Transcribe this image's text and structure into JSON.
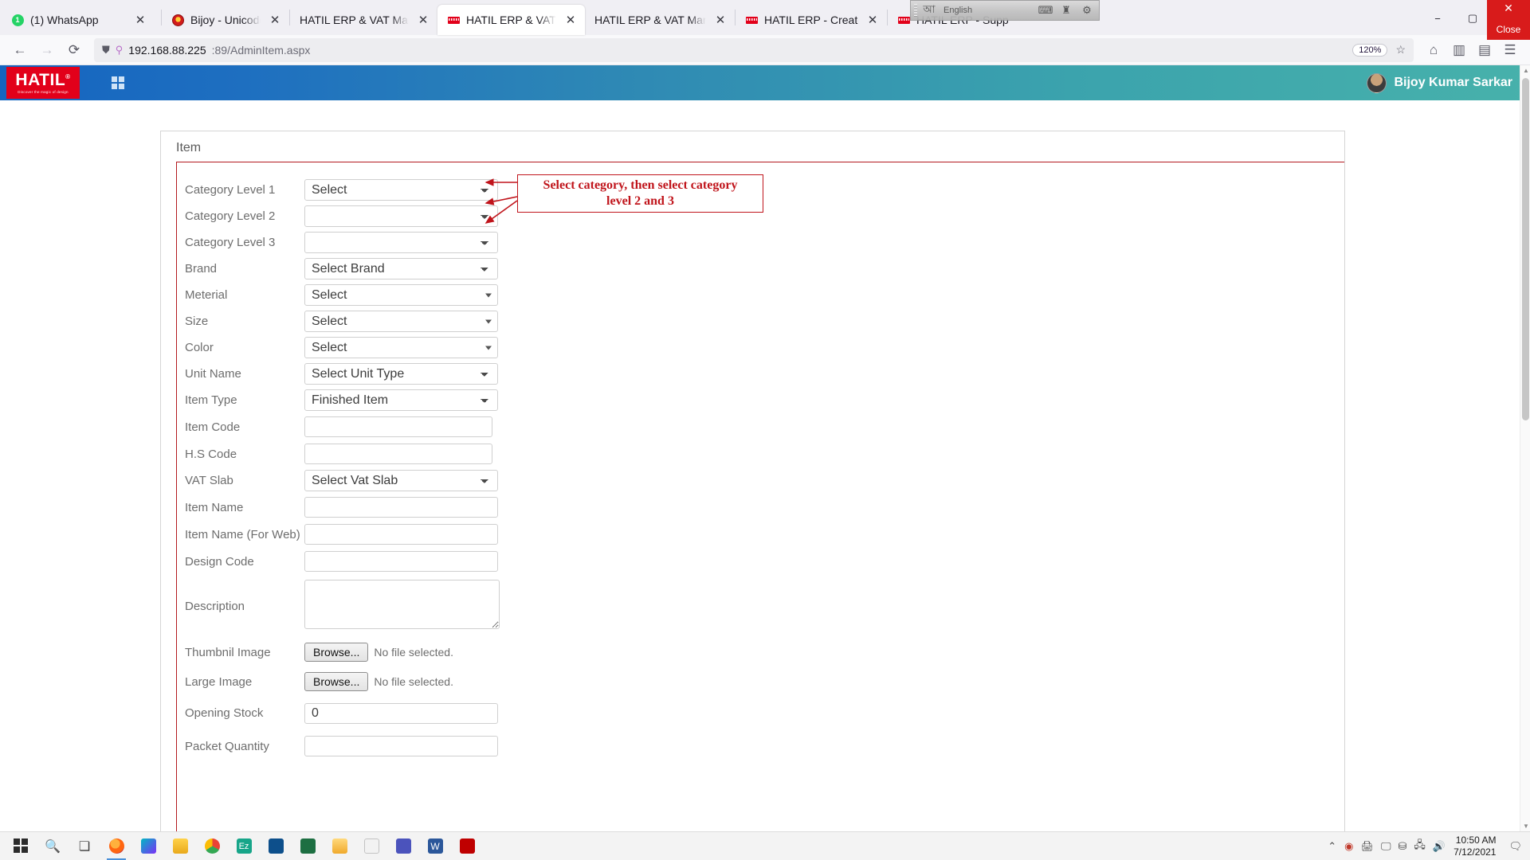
{
  "browser": {
    "tabs": [
      {
        "title": "(1) WhatsApp",
        "favicon": "whatsapp-icon",
        "active": false,
        "closable": true
      },
      {
        "title": "Bijoy - Unicode Converter | বিজ",
        "favicon": "bijoy-icon",
        "active": false,
        "closable": true
      },
      {
        "title": "HATIL ERP & VAT Management Syst",
        "favicon": "none",
        "active": false,
        "closable": true
      },
      {
        "title": "HATIL ERP & VAT Management",
        "favicon": "hatil-icon",
        "active": true,
        "closable": true
      },
      {
        "title": "HATIL ERP & VAT Management Syst",
        "favicon": "none",
        "active": false,
        "closable": true
      },
      {
        "title": "HATIL ERP - Create CDC User",
        "favicon": "hatil-icon",
        "active": false,
        "closable": true
      },
      {
        "title": "HATIL ERP - Supplier",
        "favicon": "hatil-icon",
        "active": false,
        "closable": false
      }
    ],
    "window_controls": {
      "minimize": "−",
      "maximize": "▢",
      "close": "✕"
    },
    "nav": {
      "back": "←",
      "forward": "→",
      "reload": "⟳",
      "shield_icon": "shield-icon",
      "tracking_icon": "tracking-protection-icon",
      "url_host": "192.168.88.225",
      "url_rest": ":89/AdminItem.aspx",
      "zoom_level": "120%",
      "bookmark_icon": "star-icon",
      "pocket_icon": "save-to-pocket-icon",
      "library_icon": "library-icon",
      "sidebar_icon": "sidebar-icon",
      "menu_icon": "hamburger-menu-icon"
    },
    "ime_bar": {
      "language": "English",
      "icons": [
        "ime-mode-icon",
        "keyboard-icon",
        "tool-icon",
        "settings-icon"
      ]
    },
    "overlay_close": {
      "label": "Close",
      "mark": "✕"
    }
  },
  "app": {
    "brand": {
      "name": "HATIL",
      "registered": "®",
      "tagline": "Discover the magic of design"
    },
    "grid_icon": "app-grid-icon",
    "user": {
      "name": "Bijoy Kumar Sarkar",
      "avatar": "user-avatar"
    }
  },
  "form": {
    "card_title": "Item",
    "fields": [
      {
        "label": "Category Level 1",
        "type": "select",
        "value": "Select",
        "arrow": "chevron"
      },
      {
        "label": "Category Level 2",
        "type": "select",
        "value": "",
        "arrow": "chevron"
      },
      {
        "label": "Category Level 3",
        "type": "select",
        "value": "",
        "arrow": "chevron"
      },
      {
        "label": "Brand",
        "type": "select",
        "value": "Select Brand",
        "arrow": "chevron"
      },
      {
        "label": "Meterial",
        "type": "select",
        "value": "Select",
        "arrow": "triangle"
      },
      {
        "label": "Size",
        "type": "select",
        "value": "Select",
        "arrow": "triangle"
      },
      {
        "label": "Color",
        "type": "select",
        "value": "Select",
        "arrow": "triangle"
      },
      {
        "label": "Unit Name",
        "type": "select",
        "value": "Select Unit Type",
        "arrow": "chevron"
      },
      {
        "label": "Item Type",
        "type": "select",
        "value": "Finished Item",
        "arrow": "chevron"
      },
      {
        "label": "Item Code",
        "type": "text",
        "value": "",
        "width": "short"
      },
      {
        "label": "H.S Code",
        "type": "text",
        "value": "",
        "width": "short"
      },
      {
        "label": "VAT Slab",
        "type": "select",
        "value": "Select Vat Slab",
        "arrow": "chevron"
      },
      {
        "label": "Item Name",
        "type": "text",
        "value": "",
        "width": "full"
      },
      {
        "label": "Item Name (For Web)",
        "type": "text",
        "value": "",
        "width": "full"
      },
      {
        "label": "Design Code",
        "type": "text",
        "value": "",
        "width": "full"
      },
      {
        "label": "Description",
        "type": "textarea",
        "value": ""
      },
      {
        "label": "Thumbnil Image",
        "type": "file",
        "button": "Browse...",
        "status": "No file selected."
      },
      {
        "label": "Large Image",
        "type": "file",
        "button": "Browse...",
        "status": "No file selected."
      },
      {
        "label": "Opening Stock",
        "type": "text",
        "value": "0",
        "width": "full"
      },
      {
        "label": "Packet Quantity",
        "type": "text",
        "value": "",
        "width": "full"
      }
    ],
    "annotation": {
      "line1": "Select category, then select category",
      "line2": "level 2 and 3",
      "color": "#c0141b"
    }
  },
  "taskbar": {
    "start_icon": "windows-start-icon",
    "search_icon": "search-icon",
    "taskview_icon": "task-view-icon",
    "apps": [
      {
        "icon": "firefox-icon"
      },
      {
        "icon": "paint-3d-icon"
      },
      {
        "icon": "file-explorer-icon"
      },
      {
        "icon": "chrome-icon"
      },
      {
        "icon": "ez-app-icon"
      },
      {
        "icon": "vscode-icon"
      },
      {
        "icon": "excel-icon"
      },
      {
        "icon": "folder-icon"
      },
      {
        "icon": "snip-sketch-icon"
      },
      {
        "icon": "teams-icon"
      },
      {
        "icon": "word-icon"
      },
      {
        "icon": "filezilla-icon"
      }
    ],
    "tray": {
      "chevron": "show-hidden-icons",
      "icons": [
        "bijoy-tray-icon",
        "printer-icon",
        "display-icon",
        "usb-icon",
        "network-icon",
        "volume-icon"
      ],
      "time": "10:50 AM",
      "date": "7/12/2021",
      "notification_icon": "action-center-icon"
    }
  }
}
